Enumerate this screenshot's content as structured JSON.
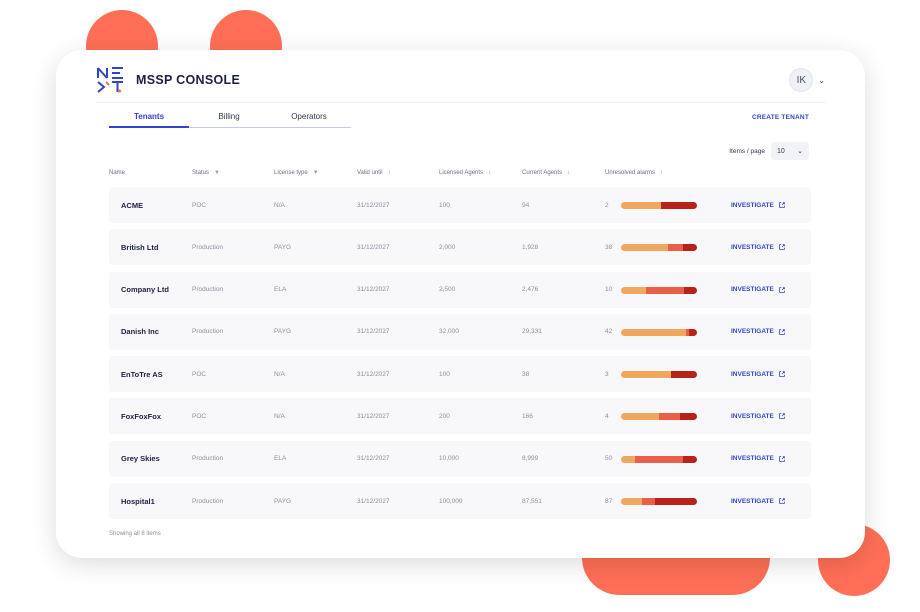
{
  "app": {
    "title": "MSSP CONSOLE",
    "user_initials": "IK"
  },
  "tabs": [
    {
      "label": "Tenants",
      "active": true
    },
    {
      "label": "Billing"
    },
    {
      "label": "Operators"
    }
  ],
  "actions": {
    "create_tenant": "CREATE TENANT"
  },
  "pagination": {
    "items_per_page_label": "Items / page",
    "items_per_page_value": "10"
  },
  "columns": [
    "Name",
    "Status",
    "License type",
    "Valid until",
    "Licensed Agents",
    "Current Agents",
    "Unresolved alarms"
  ],
  "investigate_label": "INVESTIGATE",
  "alarm_colors": [
    "#f0a860",
    "#e8604a",
    "#b8221c"
  ],
  "rows": [
    {
      "name": "ACME",
      "status": "POC",
      "license": "N/A",
      "valid": "31/12/2027",
      "licensed": "100",
      "current": "94",
      "alarms": "2",
      "severity_fractions": [
        0.52,
        0,
        0.48
      ]
    },
    {
      "name": "British Ltd",
      "status": "Production",
      "license": "PAYG",
      "valid": "31/12/2027",
      "licensed": "2,000",
      "current": "1,928",
      "alarms": "38",
      "severity_fractions": [
        0.62,
        0.2,
        0.18
      ]
    },
    {
      "name": "Company Ltd",
      "status": "Production",
      "license": "ELA",
      "valid": "31/12/2027",
      "licensed": "2,500",
      "current": "2,476",
      "alarms": "10",
      "severity_fractions": [
        0.33,
        0.5,
        0.17
      ]
    },
    {
      "name": "Danish Inc",
      "status": "Production",
      "license": "PAYG",
      "valid": "31/12/2027",
      "licensed": "32,000",
      "current": "29,331",
      "alarms": "42",
      "severity_fractions": [
        0.86,
        0.04,
        0.1
      ]
    },
    {
      "name": "EnToTre AS",
      "status": "POC",
      "license": "N/A",
      "valid": "31/12/2027",
      "licensed": "100",
      "current": "38",
      "alarms": "3",
      "severity_fractions": [
        0.66,
        0,
        0.34
      ]
    },
    {
      "name": "FoxFoxFox",
      "status": "POC",
      "license": "N/A",
      "valid": "31/12/2027",
      "licensed": "200",
      "current": "166",
      "alarms": "4",
      "severity_fractions": [
        0.5,
        0.27,
        0.23
      ]
    },
    {
      "name": "Grey Skies",
      "status": "Production",
      "license": "ELA",
      "valid": "31/12/2027",
      "licensed": "10,000",
      "current": "8,999",
      "alarms": "50",
      "severity_fractions": [
        0.18,
        0.64,
        0.18
      ]
    },
    {
      "name": "Hospital1",
      "status": "Production",
      "license": "PAYG",
      "valid": "31/12/2027",
      "licensed": "100,000",
      "current": "87,551",
      "alarms": "87",
      "severity_fractions": [
        0.27,
        0.18,
        0.55
      ]
    }
  ],
  "footer": {
    "summary": "Showing all 8 items"
  }
}
